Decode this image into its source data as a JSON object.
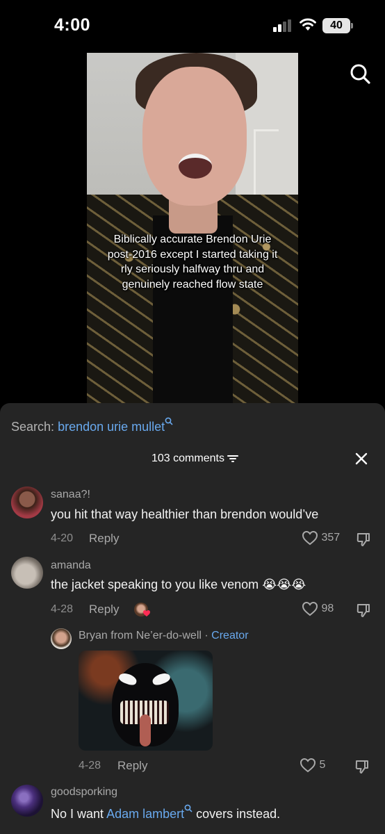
{
  "status": {
    "time": "4:00",
    "battery": "40"
  },
  "video": {
    "caption": "Biblically accurate Brendon Urie post-2016 except I started taking it rly seriously halfway thru and genuinely reached flow state"
  },
  "sheet": {
    "search_prefix": "Search:",
    "search_term": "brendon urie mullet",
    "comment_count": "103 comments",
    "comments": [
      {
        "username": "sanaa?!",
        "text": "you hit that way healthier than brendon would’ve",
        "date": "4-20",
        "reply": "Reply",
        "likes": "357"
      },
      {
        "username": "amanda",
        "text": "the jacket speaking to you like venom",
        "emoji": "😭😭😭",
        "date": "4-28",
        "reply": "Reply",
        "likes": "98"
      },
      {
        "username": "Bryan from Ne’er-do-well",
        "creator_sep": "·",
        "creator_label": "Creator",
        "date": "4-28",
        "reply": "Reply",
        "likes": "5"
      },
      {
        "username": "goodsporking",
        "text_pre": "No I want",
        "mention": "Adam lambert",
        "text_post": "covers instead."
      }
    ]
  },
  "colors": {
    "accent": "#69a9ee",
    "sheet_bg": "#252525",
    "muted": "#a9a9a9"
  }
}
